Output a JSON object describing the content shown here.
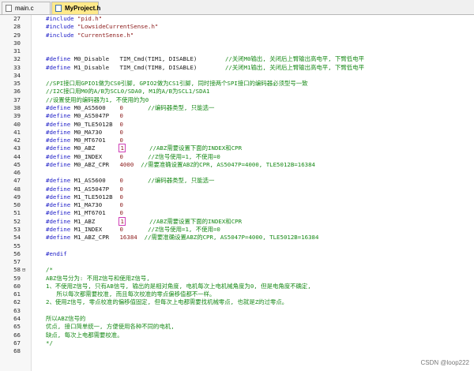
{
  "tabs": [
    {
      "label": "main.c",
      "active": false
    },
    {
      "label": "MyProject.h",
      "active": true
    }
  ],
  "lines": [
    {
      "n": "27",
      "segs": [
        [
          "kw",
          "#include "
        ],
        [
          "str",
          "\"pid.h\""
        ]
      ]
    },
    {
      "n": "28",
      "segs": [
        [
          "kw",
          "#include "
        ],
        [
          "str",
          "\"LowsideCurrentSense.h\""
        ]
      ]
    },
    {
      "n": "29",
      "segs": [
        [
          "kw",
          "#include "
        ],
        [
          "str",
          "\"CurrentSense.h\""
        ]
      ]
    },
    {
      "n": "30",
      "segs": []
    },
    {
      "n": "31",
      "segs": []
    },
    {
      "n": "32",
      "segs": [
        [
          "kw",
          "#define "
        ],
        [
          "",
          "M0_Disable   TIM_Cmd(TIM1, DISABLE)        "
        ],
        [
          "cm",
          "//关闭M0输出, 关闭后上臂输出高电平, 下臂低电平"
        ]
      ]
    },
    {
      "n": "33",
      "segs": [
        [
          "kw",
          "#define "
        ],
        [
          "",
          "M1_Disable   TIM_Cmd(TIM8, DISABLE)        "
        ],
        [
          "cm",
          "//关闭M1输出, 关闭后上臂输出高电平, 下臂低电平"
        ]
      ]
    },
    {
      "n": "34",
      "segs": []
    },
    {
      "n": "35",
      "segs": [
        [
          "cm",
          "//SPI接口用GPIO1做为CS0引脚, GPIO2做为CS1引脚, 同时接两个SPI接口的编码器必须型号一致"
        ]
      ]
    },
    {
      "n": "36",
      "segs": [
        [
          "cm",
          "//I2C接口用M0的A/B为SCL0/SDA0, M1的A/B为SCL1/SDA1"
        ]
      ]
    },
    {
      "n": "37",
      "segs": [
        [
          "cm",
          "//设置使用的编码器为1, 不使用的为0"
        ]
      ]
    },
    {
      "n": "38",
      "segs": [
        [
          "kw",
          "#define "
        ],
        [
          "",
          "M0_AS5600    "
        ],
        [
          "num",
          "0"
        ],
        [
          "",
          "       "
        ],
        [
          "cm",
          "//编码器类型, 只能选一"
        ]
      ]
    },
    {
      "n": "39",
      "segs": [
        [
          "kw",
          "#define "
        ],
        [
          "",
          "M0_AS5047P   "
        ],
        [
          "num",
          "0"
        ]
      ]
    },
    {
      "n": "40",
      "segs": [
        [
          "kw",
          "#define "
        ],
        [
          "",
          "M0_TLE5012B  "
        ],
        [
          "num",
          "0"
        ]
      ]
    },
    {
      "n": "41",
      "segs": [
        [
          "kw",
          "#define "
        ],
        [
          "",
          "M0_MA730     "
        ],
        [
          "num",
          "0"
        ]
      ]
    },
    {
      "n": "42",
      "segs": [
        [
          "kw",
          "#define "
        ],
        [
          "",
          "M0_MT6701    "
        ],
        [
          "num",
          "0"
        ]
      ]
    },
    {
      "n": "43",
      "segs": [
        [
          "kw",
          "#define "
        ],
        [
          "",
          "M0_ABZ       "
        ],
        [
          "box",
          "1"
        ],
        [
          "",
          "       "
        ],
        [
          "cm",
          "//ABZ需要设置下面的INDEX和CPR"
        ]
      ]
    },
    {
      "n": "44",
      "segs": [
        [
          "kw",
          "#define "
        ],
        [
          "",
          "M0_INDEX     "
        ],
        [
          "num",
          "0"
        ],
        [
          "",
          "       "
        ],
        [
          "cm",
          "//Z信号使用=1, 不使用=0"
        ]
      ]
    },
    {
      "n": "45",
      "segs": [
        [
          "kw",
          "#define "
        ],
        [
          "",
          "M0_ABZ_CPR   "
        ],
        [
          "num",
          "4000"
        ],
        [
          "",
          "  "
        ],
        [
          "cm",
          "//需要准确设置ABZ的CPR, AS5047P=4000, TLE5012B=16384"
        ]
      ]
    },
    {
      "n": "46",
      "segs": []
    },
    {
      "n": "47",
      "segs": [
        [
          "kw",
          "#define "
        ],
        [
          "",
          "M1_AS5600    "
        ],
        [
          "num",
          "0"
        ],
        [
          "",
          "       "
        ],
        [
          "cm",
          "//编码器类型, 只能选一"
        ]
      ]
    },
    {
      "n": "48",
      "segs": [
        [
          "kw",
          "#define "
        ],
        [
          "",
          "M1_AS5047P   "
        ],
        [
          "num",
          "0"
        ]
      ]
    },
    {
      "n": "49",
      "segs": [
        [
          "kw",
          "#define "
        ],
        [
          "",
          "M1_TLE5012B  "
        ],
        [
          "num",
          "0"
        ]
      ]
    },
    {
      "n": "50",
      "segs": [
        [
          "kw",
          "#define "
        ],
        [
          "",
          "M1_MA730     "
        ],
        [
          "num",
          "0"
        ]
      ]
    },
    {
      "n": "51",
      "segs": [
        [
          "kw",
          "#define "
        ],
        [
          "",
          "M1_MT6701    "
        ],
        [
          "num",
          "0"
        ]
      ]
    },
    {
      "n": "52",
      "segs": [
        [
          "kw",
          "#define "
        ],
        [
          "",
          "M1_ABZ       "
        ],
        [
          "box",
          "1"
        ],
        [
          "",
          "       "
        ],
        [
          "cm",
          "//ABZ需要设置下面的INDEX和CPR"
        ]
      ]
    },
    {
      "n": "53",
      "segs": [
        [
          "kw",
          "#define "
        ],
        [
          "",
          "M1_INDEX     "
        ],
        [
          "num",
          "0"
        ],
        [
          "",
          "       "
        ],
        [
          "cm",
          "//Z信号使用=1, 不使用=0"
        ]
      ]
    },
    {
      "n": "54",
      "segs": [
        [
          "kw",
          "#define "
        ],
        [
          "",
          "M1_ABZ_CPR   "
        ],
        [
          "num",
          "16384"
        ],
        [
          "",
          "  "
        ],
        [
          "cm",
          "//需要准确设置ABZ的CPR, AS5047P=4000, TLE5012B=16384"
        ]
      ]
    },
    {
      "n": "55",
      "segs": []
    },
    {
      "n": "56",
      "segs": [
        [
          "kw",
          "#endif"
        ]
      ]
    },
    {
      "n": "57",
      "segs": []
    },
    {
      "n": "58",
      "fold": "⊟",
      "segs": [
        [
          "cm",
          "/*"
        ]
      ]
    },
    {
      "n": "59",
      "segs": [
        [
          "cm",
          "ABZ信号分为: 不用Z信号和使用Z信号,"
        ]
      ]
    },
    {
      "n": "60",
      "segs": [
        [
          "cm",
          "1、不使用Z信号, 只有AB信号, 输出的是相对角度, 电机每次上电机械角度为0, 但是电角度不确定,"
        ]
      ]
    },
    {
      "n": "61",
      "segs": [
        [
          "cm",
          "   所以每次都需要校准, 而且每次校准的零点偏移值都不一样。"
        ]
      ]
    },
    {
      "n": "62",
      "segs": [
        [
          "cm",
          "2、使用Z信号, 零点校准的偏移值固定, 但每次上电都需要找机械零点, 也就是Z的过零点。"
        ]
      ]
    },
    {
      "n": "63",
      "segs": []
    },
    {
      "n": "64",
      "segs": [
        [
          "cm",
          "所以ABZ信号的"
        ]
      ]
    },
    {
      "n": "65",
      "segs": [
        [
          "cm",
          "优点, 接口简单统一, 方便使用各种不同的电机,"
        ]
      ]
    },
    {
      "n": "66",
      "segs": [
        [
          "cm",
          "缺点, 每次上电都需要校准。"
        ]
      ]
    },
    {
      "n": "67",
      "segs": [
        [
          "cm",
          "*/"
        ]
      ]
    },
    {
      "n": "68",
      "segs": []
    }
  ],
  "watermark": "CSDN @loop222"
}
